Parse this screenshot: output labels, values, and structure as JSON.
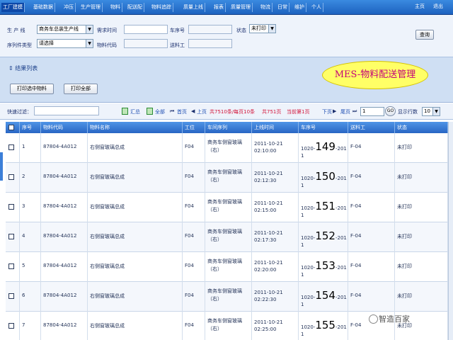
{
  "nav": {
    "items": [
      "工厂建模",
      "基础数据",
      "冲压",
      "生产管理",
      "物料",
      "配送配",
      "物料追踪",
      "质量上线",
      "报表",
      "质量管理",
      "物流",
      "日常",
      "维护",
      "个人"
    ],
    "active_index": 0,
    "right": [
      "主页",
      "退出"
    ]
  },
  "filters": {
    "production_label": "生 产 线",
    "production_value": "商务车总装生产线",
    "time_label": "需求时间",
    "car_label": "车序号",
    "status_label": "状态",
    "status_value": "未打印",
    "sequence_label": "序列件类型",
    "sequence_value": "请选择",
    "material_label": "物料代码",
    "delivery_label": "送料工",
    "query_label": "查询"
  },
  "result": {
    "title": "结果列表",
    "print_selected": "打印选中物料",
    "print_all": "打印全部",
    "badge": "MES-物料配送管理"
  },
  "pager": {
    "quick_label": "快速过滤：",
    "summary_selected": "汇总",
    "summary_all": "全部",
    "first": "首页",
    "prev": "上页",
    "info1": "共7510条/每页10条",
    "info2": "共751页",
    "current": "当前第1页",
    "next": "下页",
    "last": "尾页",
    "page_value": "1",
    "go": "GO",
    "per_page_label": "显示行数",
    "per_page_value": "10"
  },
  "table": {
    "columns": [
      "序号",
      "物料代码",
      "物料名称",
      "工位",
      "车间序列",
      "上线时间",
      "车序号",
      "送料工",
      "状态"
    ],
    "rows": [
      {
        "no": "1",
        "code": "87804-4A012",
        "name": "右侧窗玻璃总成",
        "station": "F04",
        "series": "商务车侧窗玻璃（右）",
        "time": "2011-10-21 02:10:00",
        "seq_pre": "1020-",
        "seq_big": "149",
        "seq_post": "-201",
        "seq_tail": "1",
        "worker": "F-04",
        "status": "未打印"
      },
      {
        "no": "2",
        "code": "87804-4A012",
        "name": "右侧窗玻璃总成",
        "station": "F04",
        "series": "商务车侧窗玻璃（右）",
        "time": "2011-10-21 02:12:30",
        "seq_pre": "1020-",
        "seq_big": "150",
        "seq_post": "-201",
        "seq_tail": "1",
        "worker": "F-04",
        "status": "未打印"
      },
      {
        "no": "3",
        "code": "87804-4A012",
        "name": "右侧窗玻璃总成",
        "station": "F04",
        "series": "商务车侧窗玻璃（右）",
        "time": "2011-10-21 02:15:00",
        "seq_pre": "1020-",
        "seq_big": "151",
        "seq_post": "-201",
        "seq_tail": "1",
        "worker": "F-04",
        "status": "未打印"
      },
      {
        "no": "4",
        "code": "87804-4A012",
        "name": "右侧窗玻璃总成",
        "station": "F04",
        "series": "商务车侧窗玻璃（右）",
        "time": "2011-10-21 02:17:30",
        "seq_pre": "1020-",
        "seq_big": "152",
        "seq_post": "-201",
        "seq_tail": "1",
        "worker": "F-04",
        "status": "未打印"
      },
      {
        "no": "5",
        "code": "87804-4A012",
        "name": "右侧窗玻璃总成",
        "station": "F04",
        "series": "商务车侧窗玻璃（右）",
        "time": "2011-10-21 02:20:00",
        "seq_pre": "1020-",
        "seq_big": "153",
        "seq_post": "-201",
        "seq_tail": "1",
        "worker": "F-04",
        "status": "未打印"
      },
      {
        "no": "6",
        "code": "87804-4A012",
        "name": "右侧窗玻璃总成",
        "station": "F04",
        "series": "商务车侧窗玻璃（右）",
        "time": "2011-10-21 02:22:30",
        "seq_pre": "1020-",
        "seq_big": "154",
        "seq_post": "-201",
        "seq_tail": "1",
        "worker": "F-04",
        "status": "未打印"
      },
      {
        "no": "7",
        "code": "87804-4A012",
        "name": "右侧窗玻璃总成",
        "station": "F04",
        "series": "商务车侧窗玻璃（右）",
        "time": "2011-10-21 02:25:00",
        "seq_pre": "1020-",
        "seq_big": "155",
        "seq_post": "-201",
        "seq_tail": "1",
        "worker": "F-04",
        "status": "未打印"
      }
    ]
  },
  "watermark": "智造百家"
}
